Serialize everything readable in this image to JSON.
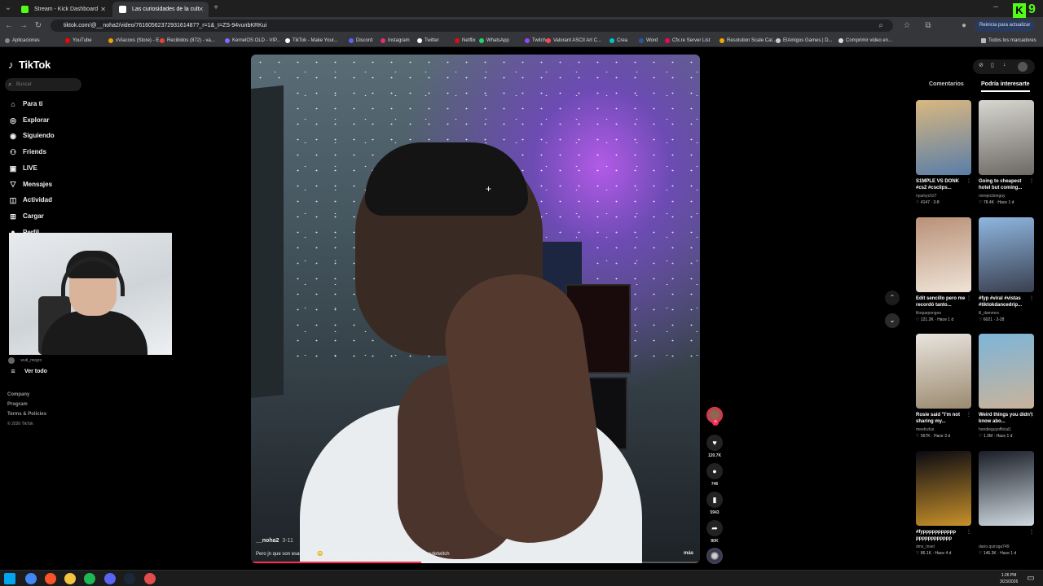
{
  "browser": {
    "tabs": [
      {
        "title": "Stream - Kick Dashboard",
        "favicon_color": "#53fc18"
      },
      {
        "title": "Las curiosidades de la cult",
        "favicon_color": "#ffffff"
      }
    ],
    "address": "tiktok.com/@__noha2/video/7616056237293161487?_r=1&_t=ZS-94vunbKRKui",
    "restart_label": "Reinicia para actualizar",
    "bookmarks": [
      {
        "label": "Aplicaciones",
        "color": "#888"
      },
      {
        "label": "YouTube",
        "color": "#ff0000"
      },
      {
        "label": "xViacoxs (Store) - E...",
        "color": "#f0a000"
      },
      {
        "label": "Recibidos (872) - va...",
        "color": "#ea4335"
      },
      {
        "label": "KernelOS OLD - VIP...",
        "color": "#7c6cff"
      },
      {
        "label": "TikTok - Make Your...",
        "color": "#ffffff"
      },
      {
        "label": "Discord",
        "color": "#5865f2"
      },
      {
        "label": "Instagram",
        "color": "#e1306c"
      },
      {
        "label": "Twitter",
        "color": "#ffffff"
      },
      {
        "label": "Netflix",
        "color": "#e50914"
      },
      {
        "label": "WhatsApp",
        "color": "#25d366"
      },
      {
        "label": "Twitch",
        "color": "#9146ff"
      },
      {
        "label": "Valorant ASCII Art C...",
        "color": "#ff4655"
      },
      {
        "label": "Crea",
        "color": "#00c4cc"
      },
      {
        "label": "Word",
        "color": "#2b579a"
      },
      {
        "label": "Cfx.re Server List",
        "color": "#f40552"
      },
      {
        "label": "Resolution Scale Cal...",
        "color": "#f7a600"
      },
      {
        "label": "ElAmigos Games | D...",
        "color": "#cccccc"
      },
      {
        "label": "Comprimir video en...",
        "color": "#dddddd"
      }
    ],
    "all_bookmarks": "Todos los marcadores"
  },
  "tiktok": {
    "logo": "TikTok",
    "search_placeholder": "Buscar",
    "nav": [
      {
        "label": "Para ti",
        "icon": "home-icon",
        "glyph": "⌂"
      },
      {
        "label": "Explorar",
        "icon": "compass-icon",
        "glyph": "◎"
      },
      {
        "label": "Siguiendo",
        "icon": "following-icon",
        "glyph": "◉"
      },
      {
        "label": "Friends",
        "icon": "friends-icon",
        "glyph": "⚇"
      },
      {
        "label": "LIVE",
        "icon": "live-icon",
        "glyph": "▣"
      },
      {
        "label": "Mensajes",
        "icon": "messages-icon",
        "glyph": "▽"
      },
      {
        "label": "Actividad",
        "icon": "activity-icon",
        "glyph": "◫"
      },
      {
        "label": "Cargar",
        "icon": "upload-icon",
        "glyph": "⊞"
      },
      {
        "label": "Perfil",
        "icon": "profile-icon",
        "glyph": "●"
      }
    ],
    "following_user": "wuti_megro",
    "see_all": "Ver todo",
    "footer": [
      "Company",
      "Program",
      "Terms & Policies"
    ],
    "copyright": "© 2026 TikTok"
  },
  "video": {
    "author": "__noha2",
    "date": "3-11",
    "caption": "Pero jn que son esas cosas 😳 #pelicanger #andresitow #pablots #laparce #clipsdetwitch",
    "more": "más",
    "progress": 0.38,
    "likes": "120.7K",
    "comments": "746",
    "saves": "5943",
    "shares": "80K"
  },
  "right_panel": {
    "tabs": [
      "Comentarios",
      "Podría interesarte"
    ],
    "active_tab": 1,
    "cards": [
      {
        "title": "S1MPLE VS DONK #cs2 #csclips...",
        "user": "nyamych27",
        "views": "4147",
        "date": "3-8",
        "colors": [
          "#d9b780",
          "#5a7ea8"
        ]
      },
      {
        "title": "Going to cheapest hotel but coming...",
        "user": "norejectionguy",
        "views": "78.4K",
        "date": "Hace 1 d",
        "colors": [
          "#d8d6d0",
          "#6d6a66"
        ]
      },
      {
        "title": "Edit sencillo pero me recordó tanto...",
        "user": "illoquepongoo",
        "views": "121.2K",
        "date": "Hace 1 d",
        "colors": [
          "#b99178",
          "#efe3d6"
        ]
      },
      {
        "title": "#fyp #viral #vistas #tiktokdancedrip...",
        "user": "ill_dammxx",
        "views": "6021",
        "date": "2-28",
        "colors": [
          "#8fb6e0",
          "#3a4050"
        ]
      },
      {
        "title": "Rosie said \"I'm not sharing my...",
        "user": "meetrufus",
        "views": "567K",
        "date": "Hace 3 d",
        "colors": [
          "#e8e4de",
          "#9c8a70"
        ]
      },
      {
        "title": "Weird things you didn't know abo...",
        "user": "hoodieguyofficial1",
        "views": "1.3M",
        "date": "Hace 1 d",
        "colors": [
          "#7db5d8",
          "#c9b39b"
        ]
      },
      {
        "title": "#fyppppppppppp pppppppppppp",
        "user": "dmx_mxel",
        "views": "86.1K",
        "date": "Hace 4 d",
        "colors": [
          "#0a0a12",
          "#c8902a"
        ]
      },
      {
        "title": "",
        "user": "dario.quiroga749",
        "views": "146.3K",
        "date": "Hace 1 d",
        "colors": [
          "#1a1e26",
          "#cfd8e0"
        ]
      }
    ]
  },
  "taskbar": {
    "time": "1:26 PM",
    "date": "3/23/2026",
    "apps": [
      "#00a4ef",
      "#4285f4",
      "#fb542b",
      "#f5c542",
      "#1db954",
      "#5865f2",
      "#1b2838",
      "#e34c4c"
    ]
  },
  "overlay": {
    "kick_number": "9"
  }
}
